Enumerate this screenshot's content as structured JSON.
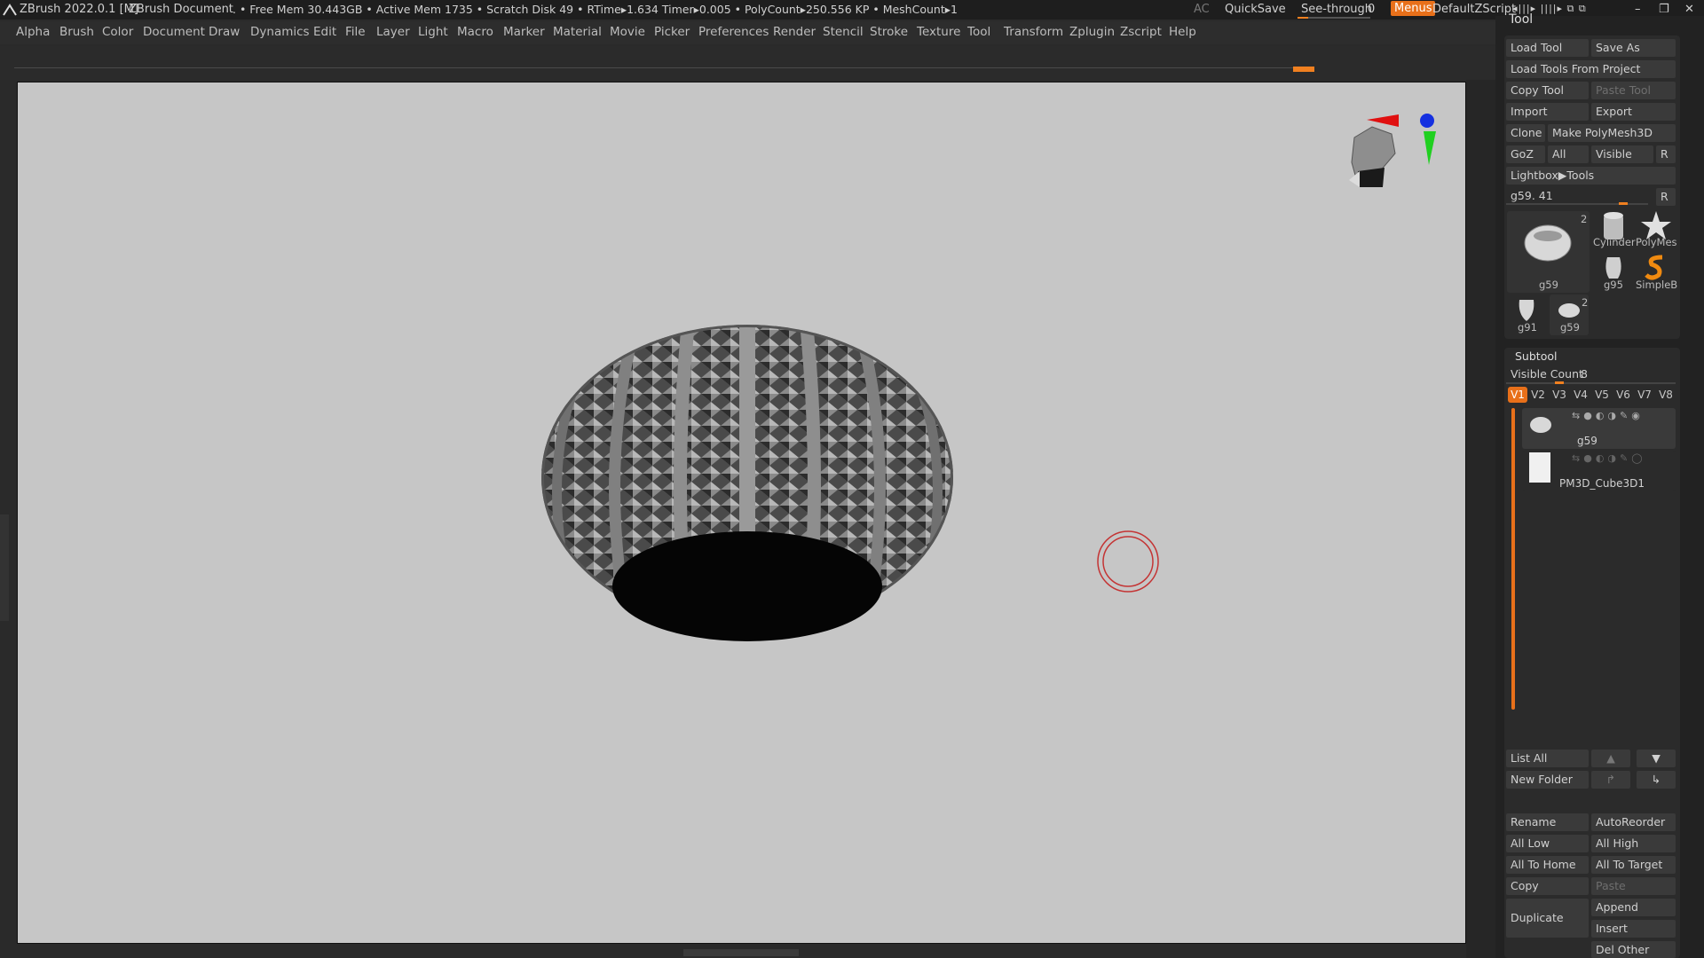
{
  "titlebar": {
    "app_title": "ZBrush 2022.0.1 [M]",
    "document": "ZBrush Document",
    "stats": ". • Free Mem 30.443GB • Active Mem 1735 • Scratch Disk 49 •  RTime▸1.634 Timer▸0.005 • PolyCount▸250.556 KP  • MeshCount▸1",
    "ac": "AC",
    "quicksave": "QuickSave",
    "see_through_label": "See-through",
    "see_through_value": "0",
    "menus": "Menus",
    "script": "DefaultZScript"
  },
  "menu": [
    "Alpha",
    "Brush",
    "Color",
    "Document",
    "Draw",
    "Dynamics",
    "Edit",
    "File",
    "Layer",
    "Light",
    "Macro",
    "Marker",
    "Material",
    "Movie",
    "Picker",
    "Preferences",
    "Render",
    "Stencil",
    "Stroke",
    "Texture",
    "Tool",
    "Transform",
    "Zplugin",
    "Zscript",
    "Help"
  ],
  "tool_panel": {
    "title": "Tool",
    "load_tool": "Load Tool",
    "save_as": "Save As",
    "load_from_project": "Load Tools From Project",
    "copy_tool": "Copy Tool",
    "paste_tool": "Paste Tool",
    "import": "Import",
    "export": "Export",
    "clone": "Clone",
    "make_polymesh": "Make PolyMesh3D",
    "goz": "GoZ",
    "all": "All",
    "visible": "Visible",
    "r": "R",
    "lightbox": "Lightbox▶Tools",
    "current_tool": "g59. 41",
    "r2": "R",
    "thumbs": {
      "big_label": "g59",
      "big_count": "2",
      "cylinder": "Cylinder",
      "polymesh": "PolyMes",
      "g95": "g95",
      "simpleb": "SimpleB",
      "g91": "g91",
      "g59_small": "g59",
      "g59_small_count": "2"
    }
  },
  "subtool": {
    "title": "Subtool",
    "visible_count_label": "Visible Count",
    "visible_count": "8",
    "tabs": [
      "V1",
      "V2",
      "V3",
      "V4",
      "V5",
      "V6",
      "V7",
      "V8"
    ],
    "items": [
      "g59",
      "PM3D_Cube3D1"
    ],
    "list_all": "List All",
    "new_folder": "New Folder",
    "rename": "Rename",
    "autoreorder": "AutoReorder",
    "all_low": "All Low",
    "all_high": "All High",
    "all_to_home": "All To Home",
    "all_to_target": "All To Target",
    "copy": "Copy",
    "paste": "Paste",
    "duplicate": "Duplicate",
    "append": "Append",
    "insert": "Insert",
    "del_other": "Del Other"
  },
  "colors": {
    "accent": "#e8701a",
    "canvas": "#c6c6c6",
    "panel": "#222222",
    "button": "#3a3a3a"
  }
}
